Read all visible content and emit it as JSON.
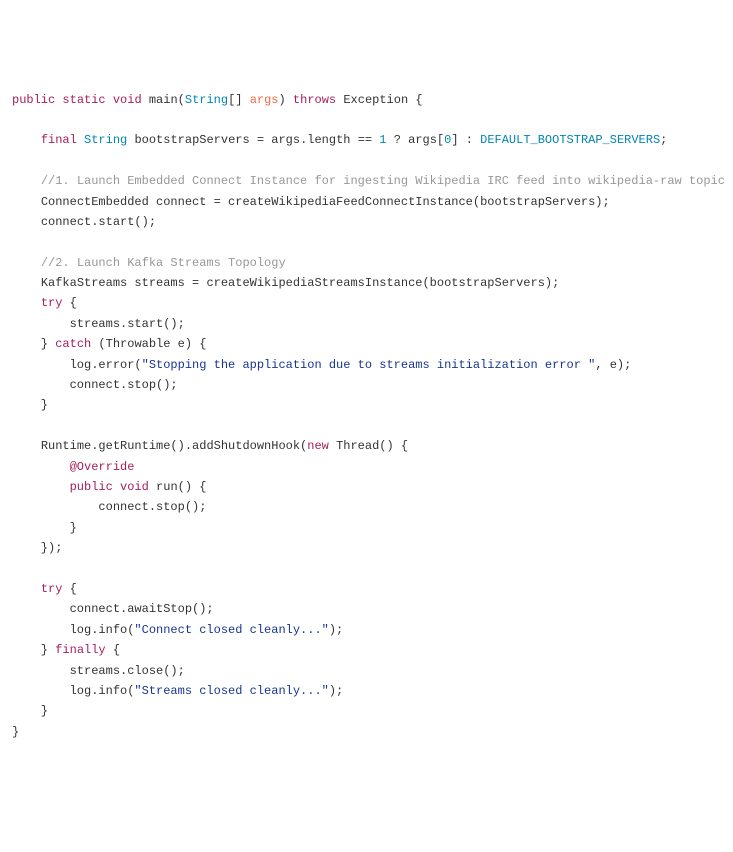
{
  "code": {
    "l1_public": "public",
    "l1_static": "static",
    "l1_void": "void",
    "l1_main": "main",
    "l1_String": "String",
    "l1_argsparam": "args",
    "l1_throws": "throws",
    "l1_Exception": "Exception",
    "l2_final": "final",
    "l2_String": "String",
    "l2_var": "bootstrapServers = args.length == ",
    "l2_num": "1",
    "l2_tern": " ? args[",
    "l2_idx": "0",
    "l2_rest": "] : ",
    "l2_const": "DEFAULT_BOOTSTRAP_SERVERS",
    "l3_comment": "//1. Launch Embedded Connect Instance for ingesting Wikipedia IRC feed into wikipedia-raw topic",
    "l4": "ConnectEmbedded connect = createWikipediaFeedConnectInstance(bootstrapServers);",
    "l5": "connect.start();",
    "l6_comment": "//2. Launch Kafka Streams Topology",
    "l7": "KafkaStreams streams = createWikipediaStreamsInstance(bootstrapServers);",
    "l8_try": "try",
    "l9": "streams.start();",
    "l10_catch": "catch",
    "l10_rest": " (Throwable e) {",
    "l11a": "log.error(",
    "l11_str": "\"Stopping the application due to streams initialization error \"",
    "l11b": ", e);",
    "l12": "connect.stop();",
    "l13": "Runtime.getRuntime().addShutdownHook(",
    "l13_new": "new",
    "l13b": " Thread() {",
    "l14_ann": "@Override",
    "l15_public": "public",
    "l15_void": "void",
    "l15_run": "run",
    "l15_rest": "() {",
    "l16": "connect.stop();",
    "l17_try": "try",
    "l18": "connect.awaitStop();",
    "l19a": "log.info(",
    "l19_str": "\"Connect closed cleanly...\"",
    "l19b": ");",
    "l20_finally": "finally",
    "l21": "streams.close();",
    "l22a": "log.info(",
    "l22_str": "\"Streams closed cleanly...\"",
    "l22b": ");"
  }
}
